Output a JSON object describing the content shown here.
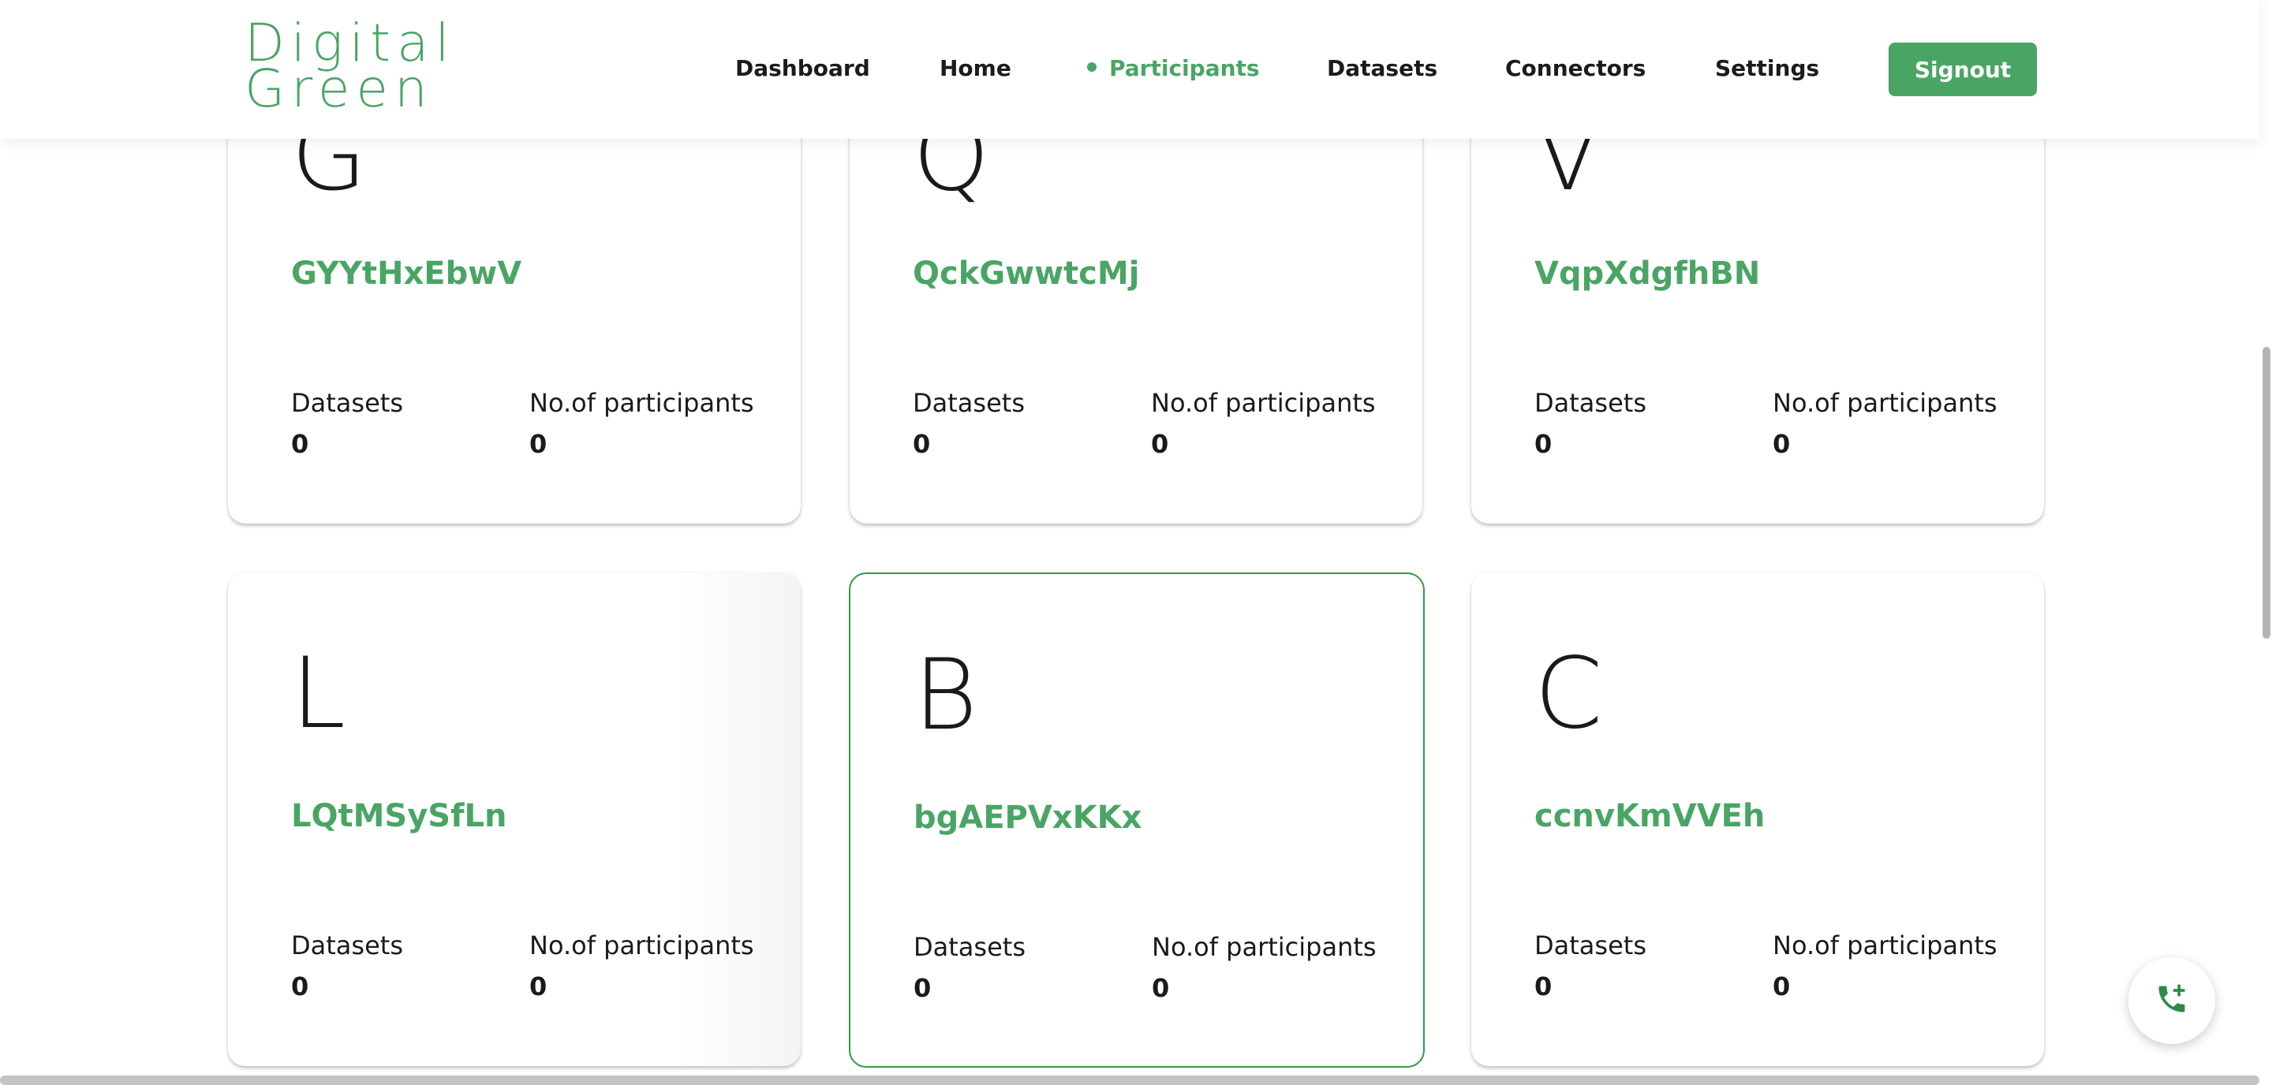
{
  "brand": {
    "logo_line1": "Digital",
    "logo_line2": "Green",
    "accent_color": "#4aa564"
  },
  "nav": {
    "items": [
      {
        "label": "Dashboard",
        "active": false
      },
      {
        "label": "Home",
        "active": false
      },
      {
        "label": "Participants",
        "active": true
      },
      {
        "label": "Datasets",
        "active": false
      },
      {
        "label": "Connectors",
        "active": false
      },
      {
        "label": "Settings",
        "active": false
      }
    ],
    "signout_label": "Signout"
  },
  "cards": [
    {
      "initial": "G",
      "name": "GYYtHxEbwV",
      "datasets_label": "Datasets",
      "datasets_value": "0",
      "participants_label": "No.of participants",
      "participants_value": "0"
    },
    {
      "initial": "Q",
      "name": "QckGwwtcMj",
      "datasets_label": "Datasets",
      "datasets_value": "0",
      "participants_label": "No.of participants",
      "participants_value": "0"
    },
    {
      "initial": "V",
      "name": "VqpXdgfhBN",
      "datasets_label": "Datasets",
      "datasets_value": "0",
      "participants_label": "No.of participants",
      "participants_value": "0"
    },
    {
      "initial": "L",
      "name": "LQtMSySfLn",
      "datasets_label": "Datasets",
      "datasets_value": "0",
      "participants_label": "No.of participants",
      "participants_value": "0"
    },
    {
      "initial": "B",
      "name": "bgAEPVxKKx",
      "datasets_label": "Datasets",
      "datasets_value": "0",
      "participants_label": "No.of participants",
      "participants_value": "0"
    },
    {
      "initial": "C",
      "name": "ccnvKmVVEh",
      "datasets_label": "Datasets",
      "datasets_value": "0",
      "participants_label": "No.of participants",
      "participants_value": "0"
    }
  ],
  "fab": {
    "icon": "phone-add-icon"
  }
}
